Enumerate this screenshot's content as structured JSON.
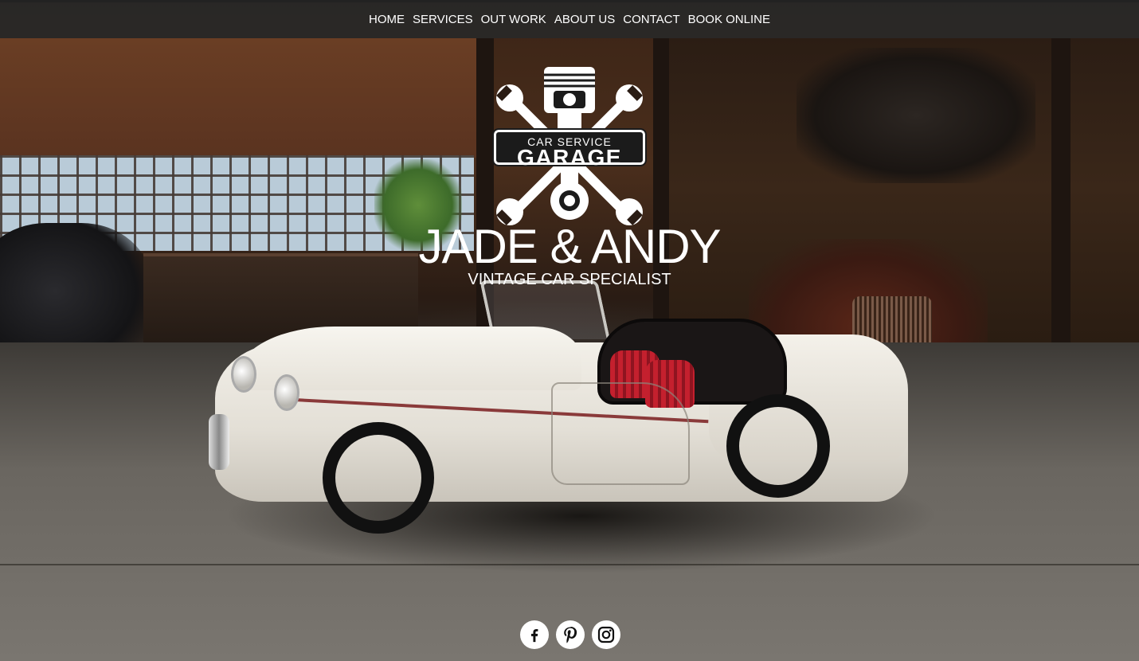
{
  "nav": {
    "items": [
      {
        "label": "HOME"
      },
      {
        "label": "SERVICES"
      },
      {
        "label": "OUT WORK"
      },
      {
        "label": "ABOUT US"
      },
      {
        "label": "CONTACT"
      },
      {
        "label": "BOOK ONLINE"
      }
    ]
  },
  "logo": {
    "line1": "CAR SERVICE",
    "line2": "GARAGE"
  },
  "hero": {
    "title": "JADE & ANDY",
    "subtitle": "VINTAGE CAR SPECIALIST"
  },
  "social": {
    "icons": [
      "facebook-icon",
      "pinterest-icon",
      "instagram-icon"
    ]
  },
  "colors": {
    "nav_bg": "#2a2a2a",
    "text": "#ffffff",
    "social_bg": "#ffffff",
    "social_glyph": "#111111"
  }
}
